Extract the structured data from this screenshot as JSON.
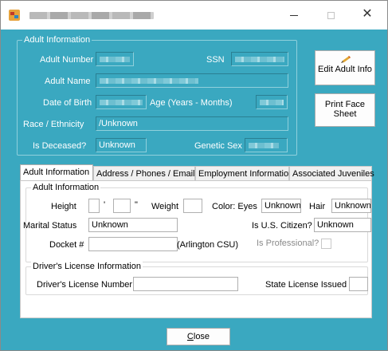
{
  "window": {
    "title_redacted": true,
    "controls": {
      "minimize": "—",
      "maximize": "☐",
      "close": "✕"
    }
  },
  "adult_info": {
    "group_title": "Adult Information",
    "adult_number_label": "Adult Number",
    "ssn_label": "SSN",
    "adult_name_label": "Adult Name",
    "dob_label": "Date of Birth",
    "age_label": "Age (Years - Months)",
    "race_label": "Race / Ethnicity",
    "race_value": "/Unknown",
    "deceased_label": "Is Deceased?",
    "deceased_value": "Unknown",
    "genetic_sex_label": "Genetic Sex"
  },
  "buttons": {
    "edit_adult_info": "Edit Adult Info",
    "print_face_sheet": "Print Face Sheet",
    "close": "Close"
  },
  "tabs": [
    {
      "label": "Adult Information",
      "active": true
    },
    {
      "label": "Address / Phones / Email",
      "active": false
    },
    {
      "label": "Employment Information",
      "active": false
    },
    {
      "label": "Associated Juveniles",
      "active": false
    }
  ],
  "tab_adult": {
    "group_title": "Adult Information",
    "height_label": "Height",
    "feet_mark": "'",
    "inches_mark": "\"",
    "weight_label": "Weight",
    "color_eyes_label": "Color: Eyes",
    "eyes_value": "Unknown",
    "hair_label": "Hair",
    "hair_value": "Unknown",
    "marital_status_label": "Marital Status",
    "marital_status_value": "Unknown",
    "us_citizen_label": "Is U.S. Citizen?",
    "us_citizen_value": "Unknown",
    "docket_label": "Docket #",
    "docket_location": "(Arlington CSU)",
    "is_professional_label": "Is Professional?"
  },
  "drivers_license": {
    "group_title": "Driver's License Information",
    "number_label": "Driver's License Number",
    "state_label": "State License Issued"
  },
  "colors": {
    "window_bg": "#3aa8c0",
    "panel_bg": "#ffffff",
    "label_on_teal": "#ffffff"
  }
}
